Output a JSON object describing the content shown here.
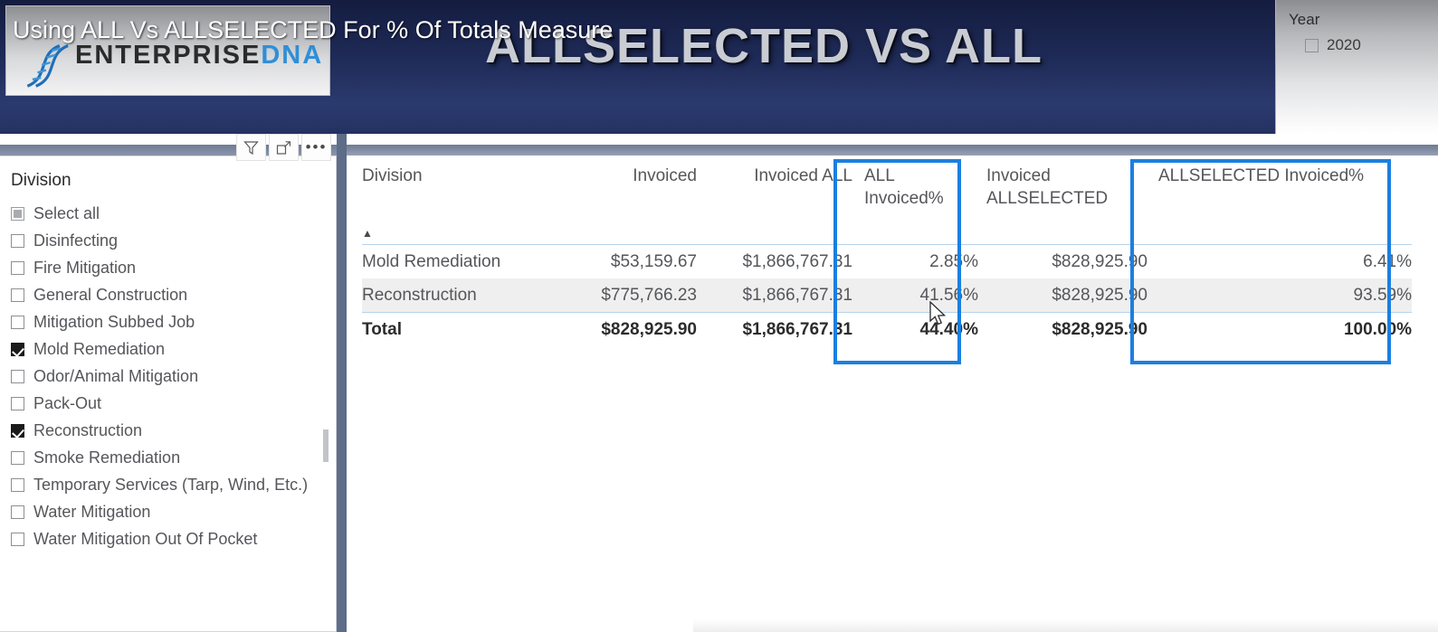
{
  "banner": {
    "title": "ALLSELECTED VS ALL",
    "overlay_title": "Using ALL Vs ALLSELECTED For % Of Totals Measure",
    "logo_primary": "ENTERPRISE",
    "logo_accent": "DNA",
    "bg_color": "#1f2b58",
    "title_color": "#c9ccd2"
  },
  "year_slicer": {
    "title": "Year",
    "items": [
      {
        "label": "2020",
        "checked": false
      }
    ]
  },
  "visual_toolbar": {
    "filter_icon": "filter-funnel-icon",
    "focus_icon": "focus-mode-icon",
    "more_label": "•••"
  },
  "division_slicer": {
    "title": "Division",
    "items": [
      {
        "label": "Select all",
        "state": "partial"
      },
      {
        "label": "Disinfecting",
        "state": "unchecked"
      },
      {
        "label": "Fire Mitigation",
        "state": "unchecked"
      },
      {
        "label": "General Construction",
        "state": "unchecked"
      },
      {
        "label": "Mitigation Subbed Job",
        "state": "unchecked"
      },
      {
        "label": "Mold Remediation",
        "state": "checked"
      },
      {
        "label": "Odor/Animal Mitigation",
        "state": "unchecked"
      },
      {
        "label": "Pack-Out",
        "state": "unchecked"
      },
      {
        "label": "Reconstruction",
        "state": "checked"
      },
      {
        "label": "Smoke Remediation",
        "state": "unchecked"
      },
      {
        "label": "Temporary Services (Tarp, Wind, Etc.)",
        "state": "unchecked"
      },
      {
        "label": "Water Mitigation",
        "state": "unchecked"
      },
      {
        "label": "Water Mitigation Out Of Pocket",
        "state": "unchecked"
      }
    ]
  },
  "matrix": {
    "columns": [
      "Division",
      "Invoiced",
      "Invoiced ALL",
      "ALL Invoiced%",
      "Invoiced ALLSELECTED",
      "ALLSELECTED Invoiced%"
    ],
    "column_lines": [
      [
        "Division"
      ],
      [
        "Invoiced"
      ],
      [
        "Invoiced ALL"
      ],
      [
        "ALL",
        "Invoiced%"
      ],
      [
        "Invoiced",
        "ALLSELECTED"
      ],
      [
        "ALLSELECTED Invoiced%"
      ]
    ],
    "sort_indicator": "▲",
    "rows": [
      {
        "division": "Mold Remediation",
        "invoiced": "$53,159.67",
        "invoiced_all": "$1,866,767.31",
        "all_invoiced_pct": "2.85%",
        "invoiced_allselected": "$828,925.90",
        "allselected_invoiced_pct": "6.41%"
      },
      {
        "division": "Reconstruction",
        "invoiced": "$775,766.23",
        "invoiced_all": "$1,866,767.31",
        "all_invoiced_pct": "41.56%",
        "invoiced_allselected": "$828,925.90",
        "allselected_invoiced_pct": "93.59%"
      }
    ],
    "total": {
      "division": "Total",
      "invoiced": "$828,925.90",
      "invoiced_all": "$1,866,767.31",
      "all_invoiced_pct": "44.40%",
      "invoiced_allselected": "$828,925.90",
      "allselected_invoiced_pct": "100.00%"
    },
    "highlight_color": "#1b7fe0",
    "highlighted_columns": [
      "ALL Invoiced%",
      "ALLSELECTED Invoiced%"
    ]
  }
}
